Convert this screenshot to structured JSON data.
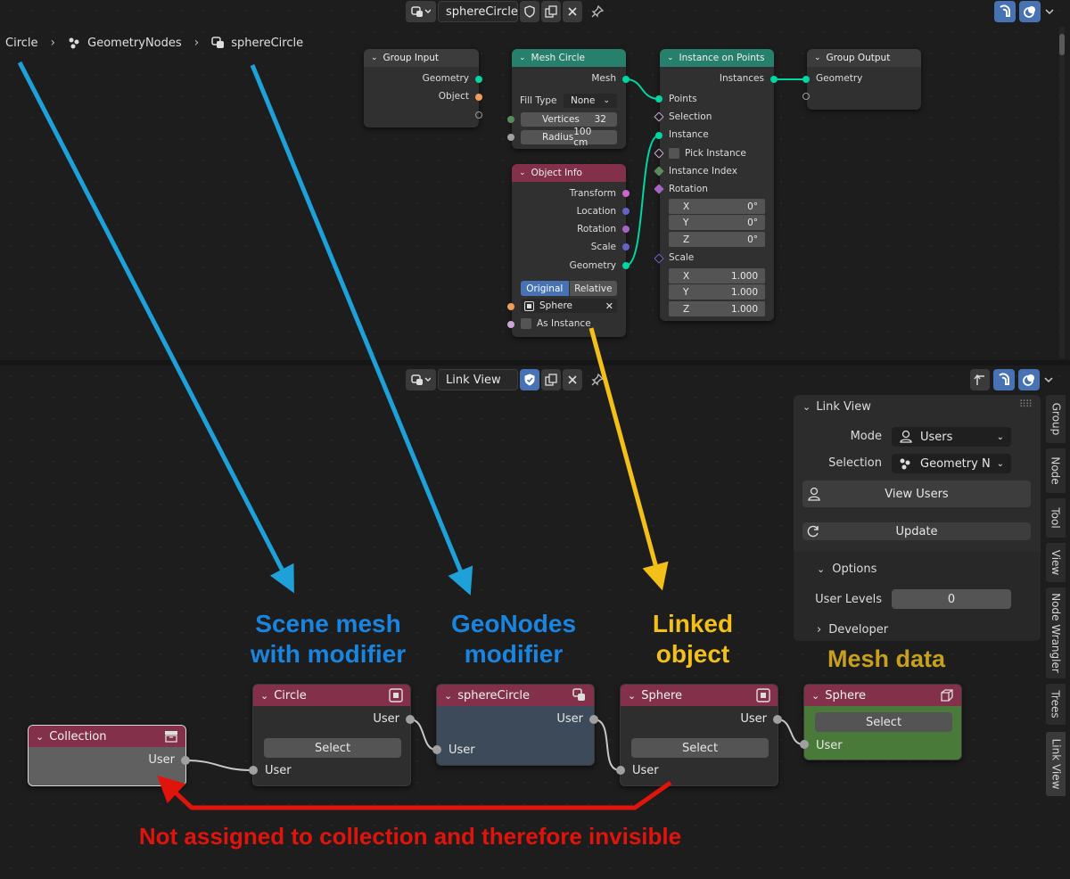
{
  "colors": {
    "blue_arrow": "#1ea0d8",
    "yellow_arrow": "#f2c018",
    "red_arrow": "#e1140c",
    "mesh_data_label": "#c8a020",
    "accent": "#4772b3"
  },
  "top_header": {
    "datablock_name": "sphereCircle"
  },
  "breadcrumb": {
    "items": [
      {
        "label": "Circle",
        "icon": "object-icon"
      },
      {
        "label": "GeometryNodes",
        "icon": "modifier-icon"
      },
      {
        "label": "sphereCircle",
        "icon": "nodetree-icon"
      }
    ]
  },
  "nodes": {
    "group_input": {
      "title": "Group Input",
      "outputs": [
        "Geometry",
        "Object"
      ]
    },
    "mesh_circle": {
      "title": "Mesh Circle",
      "output": "Mesh",
      "fill_type_label": "Fill Type",
      "fill_type_value": "None",
      "vertices_label": "Vertices",
      "vertices_value": "32",
      "radius_label": "Radius",
      "radius_value": "100 cm"
    },
    "object_info": {
      "title": "Object Info",
      "outputs": [
        "Transform",
        "Location",
        "Rotation",
        "Scale",
        "Geometry"
      ],
      "mode_original": "Original",
      "mode_relative": "Relative",
      "object_value": "Sphere",
      "as_instance": "As Instance"
    },
    "instance_on_points": {
      "title": "Instance on Points",
      "output": "Instances",
      "inputs": [
        "Points",
        "Selection",
        "Instance",
        "Pick Instance",
        "Instance Index",
        "Rotation",
        "Scale"
      ],
      "rotation": [
        {
          "axis": "X",
          "value": "0°"
        },
        {
          "axis": "Y",
          "value": "0°"
        },
        {
          "axis": "Z",
          "value": "0°"
        }
      ],
      "scale": [
        {
          "axis": "X",
          "value": "1.000"
        },
        {
          "axis": "Y",
          "value": "1.000"
        },
        {
          "axis": "Z",
          "value": "1.000"
        }
      ]
    },
    "group_output": {
      "title": "Group Output",
      "input": "Geometry"
    }
  },
  "bottom_header": {
    "datablock_name": "Link View"
  },
  "link_nodes": {
    "collection": {
      "title": "Collection",
      "output": "User"
    },
    "circle": {
      "title": "Circle",
      "output": "User",
      "button": "Select",
      "input": "User"
    },
    "spherecircle": {
      "title": "sphereCircle",
      "output": "User",
      "input": "User"
    },
    "sphere_obj": {
      "title": "Sphere",
      "output": "User",
      "button": "Select",
      "input": "User"
    },
    "sphere_mesh": {
      "title": "Sphere",
      "button": "Select",
      "input": "User"
    }
  },
  "panel": {
    "title": "Link View",
    "mode_label": "Mode",
    "mode_value": "Users",
    "selection_label": "Selection",
    "selection_value": "Geometry No...",
    "view_users": "View Users",
    "update": "Update",
    "options": "Options",
    "user_levels_label": "User Levels",
    "user_levels_value": "0",
    "developer": "Developer"
  },
  "tabs": [
    "Group",
    "Node",
    "Tool",
    "View",
    "Node Wrangler",
    "Trees",
    "Link View"
  ],
  "annotations": {
    "scene_mesh": [
      "Scene mesh",
      "with modifier"
    ],
    "geonodes": [
      "GeoNodes",
      "modifier"
    ],
    "linked_object": [
      "Linked",
      "object"
    ],
    "mesh_data": "Mesh data",
    "not_assigned": "Not assigned to collection and therefore invisible"
  }
}
